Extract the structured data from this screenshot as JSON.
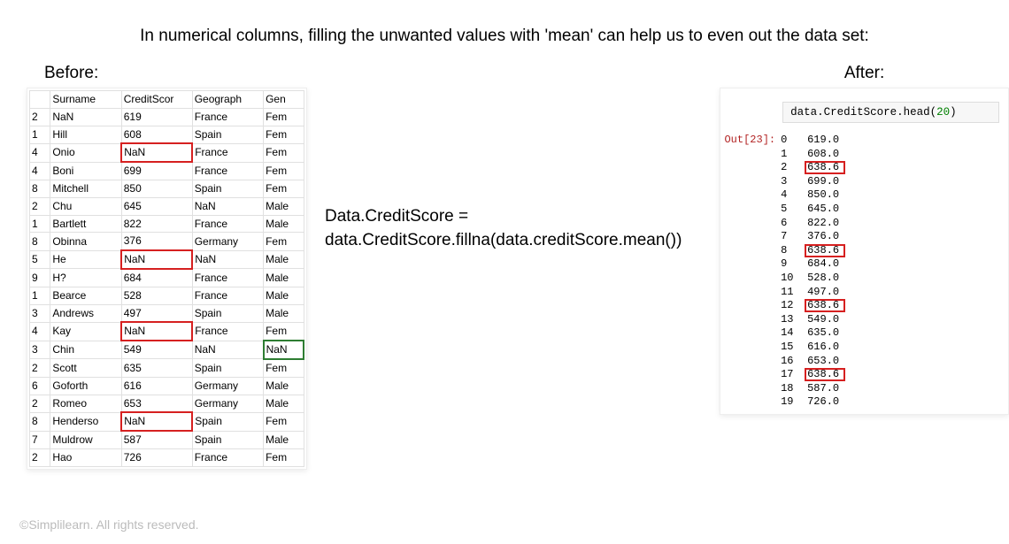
{
  "title": "In numerical columns, filling the unwanted values with 'mean' can help us to even out the data set:",
  "before_label": "Before:",
  "after_label": "After:",
  "code_line1": "Data.CreditScore =",
  "code_line2": "data.CreditScore.fillna(data.creditScore.mean())",
  "table": {
    "headers": [
      "",
      "Surname",
      "CreditScor",
      "Geograph",
      "Gen"
    ],
    "rows": [
      {
        "id": "2",
        "surname": "NaN",
        "credit": "619",
        "geo": "France",
        "gen": "Fem"
      },
      {
        "id": "1",
        "surname": "Hill",
        "credit": "608",
        "geo": "Spain",
        "gen": "Fem"
      },
      {
        "id": "4",
        "surname": "Onio",
        "credit": "NaN",
        "credit_hl": true,
        "geo": "France",
        "gen": "Fem"
      },
      {
        "id": "4",
        "surname": "Boni",
        "credit": "699",
        "geo": "France",
        "gen": "Fem"
      },
      {
        "id": "8",
        "surname": "Mitchell",
        "credit": "850",
        "geo": "Spain",
        "gen": "Fem"
      },
      {
        "id": "2",
        "surname": "Chu",
        "credit": "645",
        "geo": "NaN",
        "gen": "Male"
      },
      {
        "id": "1",
        "surname": "Bartlett",
        "credit": "822",
        "geo": "France",
        "gen": "Male"
      },
      {
        "id": "8",
        "surname": "Obinna",
        "credit": "376",
        "geo": "Germany",
        "gen": "Fem"
      },
      {
        "id": "5",
        "surname": "He",
        "credit": "NaN",
        "credit_hl": true,
        "geo": "NaN",
        "gen": "Male"
      },
      {
        "id": "9",
        "surname": "H?",
        "credit": "684",
        "geo": "France",
        "gen": "Male"
      },
      {
        "id": "1",
        "surname": "Bearce",
        "credit": "528",
        "geo": "France",
        "gen": "Male"
      },
      {
        "id": "3",
        "surname": "Andrews",
        "credit": "497",
        "geo": "Spain",
        "gen": "Male"
      },
      {
        "id": "4",
        "surname": "Kay",
        "credit": "NaN",
        "credit_hl": true,
        "geo": "France",
        "gen": "Fem"
      },
      {
        "id": "3",
        "surname": "Chin",
        "credit": "549",
        "geo": "NaN",
        "gen": "NaN",
        "gen_hl": true
      },
      {
        "id": "2",
        "surname": "Scott",
        "credit": "635",
        "geo": "Spain",
        "gen": "Fem"
      },
      {
        "id": "6",
        "surname": "Goforth",
        "credit": "616",
        "geo": "Germany",
        "gen": "Male"
      },
      {
        "id": "2",
        "surname": "Romeo",
        "credit": "653",
        "geo": "Germany",
        "gen": "Male"
      },
      {
        "id": "8",
        "surname": "Henderso",
        "credit": "NaN",
        "credit_hl": true,
        "geo": "Spain",
        "gen": "Fem"
      },
      {
        "id": "7",
        "surname": "Muldrow",
        "credit": "587",
        "geo": "Spain",
        "gen": "Male"
      },
      {
        "id": "2",
        "surname": "Hao",
        "credit": "726",
        "geo": "France",
        "gen": "Fem"
      }
    ]
  },
  "jupyter": {
    "code_pre": "data.CreditScore.head",
    "code_arg": "20",
    "out_label": "Out[23]:",
    "rows": [
      {
        "idx": "0",
        "val": "619.0"
      },
      {
        "idx": "1",
        "val": "608.0"
      },
      {
        "idx": "2",
        "val": "638.6",
        "hl": true
      },
      {
        "idx": "3",
        "val": "699.0"
      },
      {
        "idx": "4",
        "val": "850.0"
      },
      {
        "idx": "5",
        "val": "645.0"
      },
      {
        "idx": "6",
        "val": "822.0"
      },
      {
        "idx": "7",
        "val": "376.0"
      },
      {
        "idx": "8",
        "val": "638.6",
        "hl": true
      },
      {
        "idx": "9",
        "val": "684.0"
      },
      {
        "idx": "10",
        "val": "528.0"
      },
      {
        "idx": "11",
        "val": "497.0"
      },
      {
        "idx": "12",
        "val": "638.6",
        "hl": true
      },
      {
        "idx": "13",
        "val": "549.0"
      },
      {
        "idx": "14",
        "val": "635.0"
      },
      {
        "idx": "15",
        "val": "616.0"
      },
      {
        "idx": "16",
        "val": "653.0"
      },
      {
        "idx": "17",
        "val": "638.6",
        "hl": true
      },
      {
        "idx": "18",
        "val": "587.0"
      },
      {
        "idx": "19",
        "val": "726.0"
      }
    ]
  },
  "footer": "©Simplilearn. All rights reserved."
}
